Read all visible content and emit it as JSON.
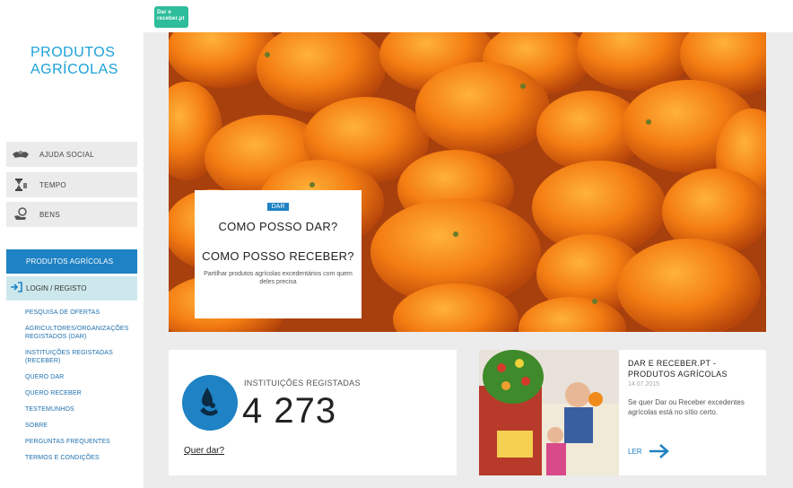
{
  "logo": {
    "text": "Dar e receber.pt"
  },
  "sidebar": {
    "brand_line1": "PRODUTOS",
    "brand_line2": "AGRÍCOLAS",
    "categories": [
      {
        "label": "AJUDA SOCIAL",
        "icon": "hands-icon"
      },
      {
        "label": "TEMPO",
        "icon": "hourglass-icon"
      },
      {
        "label": "BENS",
        "icon": "hand-coin-icon"
      }
    ],
    "active_item": "PRODUTOS AGRÍCOLAS",
    "login_label": "LOGIN / REGISTO",
    "menu": [
      "PESQUISA DE OFERTAS",
      "AGRICULTORES/ORGANIZAÇÕES REGISTADOS (DAR)",
      "INSTITUIÇÕES REGISTADAS (RECEBER)",
      "QUERO DAR",
      "QUERO RECEBER",
      "TESTEMUNHOS",
      "SOBRE",
      "PERGUNTAS FREQUENTES",
      "TERMOS E CONDIÇÕES"
    ]
  },
  "hero": {
    "tag": "DAR",
    "question1": "COMO POSSO DAR?",
    "question2": "COMO POSSO RECEBER?",
    "description": "Partilhar produtos agrícolas excedentários com quem deles precisa"
  },
  "stats": {
    "label": "INSTITUIÇÕES REGISTADAS",
    "value": "4 273",
    "link": "Quer dar?"
  },
  "news": {
    "title": "DAR E RECEBER.PT - PRODUTOS AGRÍCOLAS",
    "date": "14.07.2015",
    "body": "Se quer Dar ou Receber excedentes agrícolas está no sítio certo.",
    "more_label": "LER"
  },
  "colors": {
    "accent": "#1e82c4",
    "brand": "#1ca1d8",
    "login_bg": "#cde8ec",
    "logo": "#2dbd9b"
  }
}
